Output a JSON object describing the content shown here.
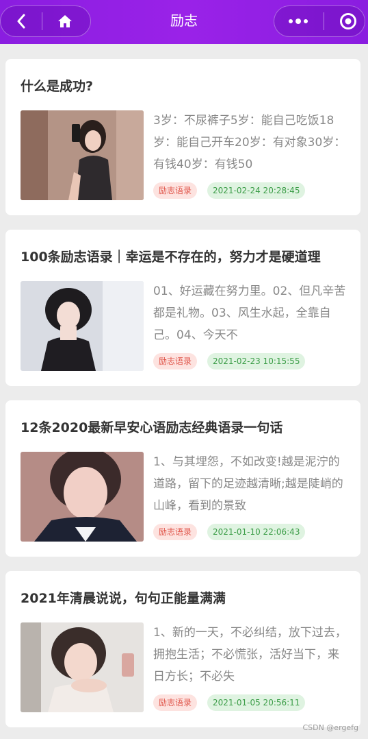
{
  "navbar": {
    "title": "励志",
    "back_icon": "back-arrow-icon",
    "home_icon": "home-icon",
    "more_icon": "more-dots-icon",
    "close_icon": "target-circle-icon",
    "bg_color": "#9a22e8"
  },
  "articles": [
    {
      "title": "什么是成功?",
      "excerpt": "3岁：不尿裤子5岁：能自己吃饭18岁：能自己开车20岁：有对象30岁：有钱40岁：有钱50",
      "tag": "励志语录",
      "date": "2021-02-24 20:28:45"
    },
    {
      "title": "100条励志语录｜幸运是不存在的，努力才是硬道理",
      "excerpt": "01、好运藏在努力里。02、但凡辛苦都是礼物。03、风生水起，全靠自己。04、今天不",
      "tag": "励志语录",
      "date": "2021-02-23 10:15:55"
    },
    {
      "title": "12条2020最新早安心语励志经典语录一句话",
      "excerpt": "1、与其埋怨，不如改变!越是泥泞的道路，留下的足迹越清晰;越是陡峭的山峰，看到的景致",
      "tag": "励志语录",
      "date": "2021-01-10 22:06:43"
    },
    {
      "title": "2021年清晨说说，句句正能量满满",
      "excerpt": "1、新的一天，不必纠结，放下过去，拥抱生活；不必慌张，活好当下，来日方长；不必失",
      "tag": "励志语录",
      "date": "2021-01-05 20:56:11"
    }
  ],
  "watermark": "CSDN @ergefg"
}
